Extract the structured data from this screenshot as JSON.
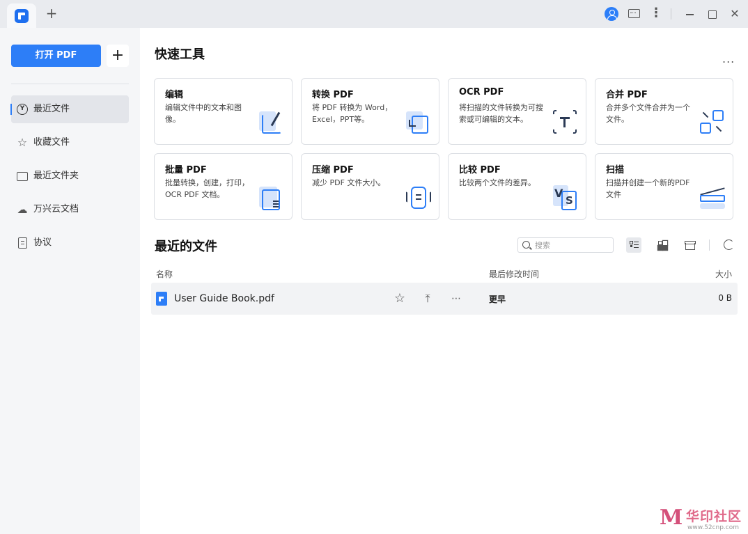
{
  "titlebar": {
    "newtab": "+",
    "more": "⋮",
    "close": "✕"
  },
  "sidebar": {
    "open_button": "打开 PDF",
    "add_button": "+",
    "items": [
      {
        "label": "最近文件",
        "icon": "clock-icon",
        "active": true
      },
      {
        "label": "收藏文件",
        "icon": "star-icon"
      },
      {
        "label": "最近文件夹",
        "icon": "folder-icon"
      },
      {
        "label": "万兴云文档",
        "icon": "cloud-icon"
      },
      {
        "label": "协议",
        "icon": "document-icon"
      }
    ]
  },
  "quick_tools": {
    "title": "快速工具",
    "more": "...",
    "cards": [
      {
        "title": "编辑",
        "desc": "编辑文件中的文本和图像。"
      },
      {
        "title": "转换 PDF",
        "desc": "将 PDF 转换为 Word，Excel，PPT等。"
      },
      {
        "title": "OCR PDF",
        "desc": "将扫描的文件转换为可搜索或可编辑的文本。"
      },
      {
        "title": "合并 PDF",
        "desc": "合并多个文件合并为一个文件。"
      },
      {
        "title": "批量 PDF",
        "desc": "批量转换，创建，打印，OCR PDF 文档。"
      },
      {
        "title": "压缩 PDF",
        "desc": "减少 PDF 文件大小。"
      },
      {
        "title": "比较 PDF",
        "desc": "比较两个文件的差异。"
      },
      {
        "title": "扫描",
        "desc": "扫描并创建一个新的PDF 文件"
      }
    ]
  },
  "recent": {
    "title": "最近的文件",
    "search_placeholder": "搜索",
    "columns": {
      "name": "名称",
      "modified": "最后修改时间",
      "size": "大小"
    },
    "files": [
      {
        "name": "User Guide Book.pdf",
        "modified": "更早",
        "size": "0 B"
      }
    ]
  },
  "watermark": {
    "text": "华印社区",
    "url": "www.52cnp.com"
  },
  "colors": {
    "accent": "#2d7ef7",
    "sidebar_bg": "#f5f6f8",
    "titlebar_bg": "#e9ebef"
  }
}
